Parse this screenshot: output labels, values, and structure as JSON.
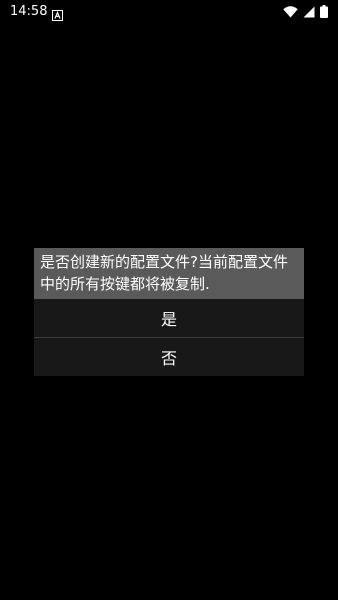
{
  "status_bar": {
    "time": "14:58",
    "notification_icon": "a-letter-notification-icon",
    "wifi_icon": "wifi-icon",
    "signal_icon": "cell-signal-icon",
    "battery_icon": "battery-icon"
  },
  "dialog": {
    "message": "是否创建新的配置文件?当前配置文件中的所有按键都将被复制.",
    "options": [
      {
        "label": "是"
      },
      {
        "label": "否"
      }
    ]
  },
  "colors": {
    "background": "#000000",
    "message_background": "#5a5a5a",
    "option_background": "#181818",
    "text": "#ffffff"
  }
}
